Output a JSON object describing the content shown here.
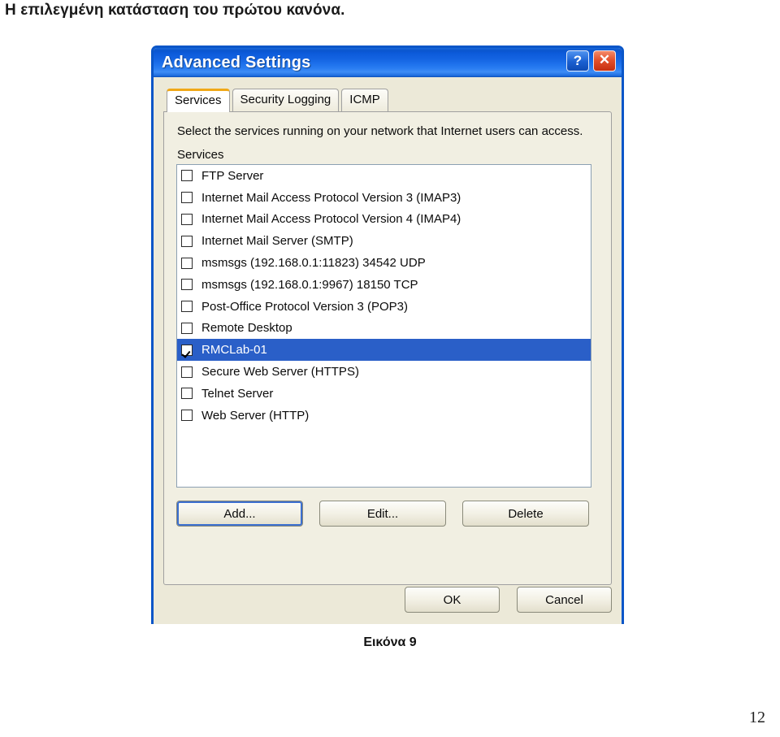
{
  "document": {
    "heading": "Η επιλεγμένη κατάσταση του πρώτου κανόνα.",
    "figure_caption": "Εικόνα 9",
    "page_number": "12"
  },
  "dialog": {
    "title": "Advanced Settings",
    "titlebar_buttons": {
      "help": "?",
      "help_icon": "question-mark-icon",
      "close": "✕",
      "close_icon": "close-x-icon"
    },
    "tabs": [
      {
        "label": "Services",
        "active": true
      },
      {
        "label": "Security Logging",
        "active": false
      },
      {
        "label": "ICMP",
        "active": false
      }
    ],
    "panel": {
      "description": "Select the services running on your network that Internet users can access.",
      "group_label": "Services",
      "services": [
        {
          "label": "FTP Server",
          "checked": false,
          "selected": false
        },
        {
          "label": "Internet Mail Access Protocol Version 3 (IMAP3)",
          "checked": false,
          "selected": false
        },
        {
          "label": "Internet Mail Access Protocol Version 4 (IMAP4)",
          "checked": false,
          "selected": false
        },
        {
          "label": "Internet Mail Server (SMTP)",
          "checked": false,
          "selected": false
        },
        {
          "label": "msmsgs (192.168.0.1:11823) 34542 UDP",
          "checked": false,
          "selected": false
        },
        {
          "label": "msmsgs (192.168.0.1:9967) 18150 TCP",
          "checked": false,
          "selected": false
        },
        {
          "label": "Post-Office Protocol Version 3 (POP3)",
          "checked": false,
          "selected": false
        },
        {
          "label": "Remote Desktop",
          "checked": false,
          "selected": false
        },
        {
          "label": "RMCLab-01",
          "checked": true,
          "selected": true
        },
        {
          "label": "Secure Web Server (HTTPS)",
          "checked": false,
          "selected": false
        },
        {
          "label": "Telnet Server",
          "checked": false,
          "selected": false
        },
        {
          "label": "Web Server (HTTP)",
          "checked": false,
          "selected": false
        }
      ],
      "buttons": {
        "add": "Add...",
        "edit": "Edit...",
        "delete": "Delete"
      }
    },
    "footer": {
      "ok": "OK",
      "cancel": "Cancel"
    },
    "colors": {
      "titlebar_blue": "#1464e2",
      "dialog_face": "#ece9d8",
      "selection_blue": "#2a5fc8",
      "active_tab_accent": "#f0a818",
      "close_red": "#e4512c"
    }
  }
}
